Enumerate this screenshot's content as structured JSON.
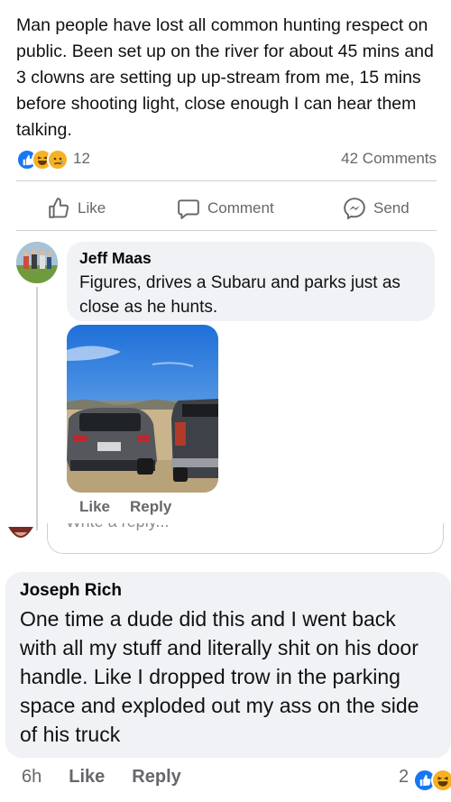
{
  "post": {
    "text": "Man people have lost all common hunting respect on public.  Been set up on the river for about 45 mins and 3 clowns are setting up up-stream from me, 15 mins before shooting light, close enough I can hear them talking.",
    "reaction_count": "12",
    "comments_count": "42 Comments",
    "reactions": [
      "like",
      "haha",
      "sad"
    ]
  },
  "actions": {
    "like_label": "Like",
    "comment_label": "Comment",
    "send_label": "Send"
  },
  "comment1": {
    "author": "Jeff Maas",
    "text": "Figures, drives a Subaru and parks just as close as he hunts.",
    "like_label": "Like",
    "reply_label": "Reply"
  },
  "reply_box": {
    "placeholder": "Write a reply..."
  },
  "comment2": {
    "author": "Joseph Rich",
    "text": "One time a dude did this and I went back with all my stuff and literally shit on his door handle. Like I dropped trow in the parking space and exploded out my ass on the side of his truck",
    "time": "6h",
    "like_label": "Like",
    "reply_label": "Reply",
    "reaction_count": "2"
  },
  "colors": {
    "brand_blue": "#1877f2",
    "secondary_text": "#65676b",
    "bubble_bg": "#f0f2f5"
  }
}
